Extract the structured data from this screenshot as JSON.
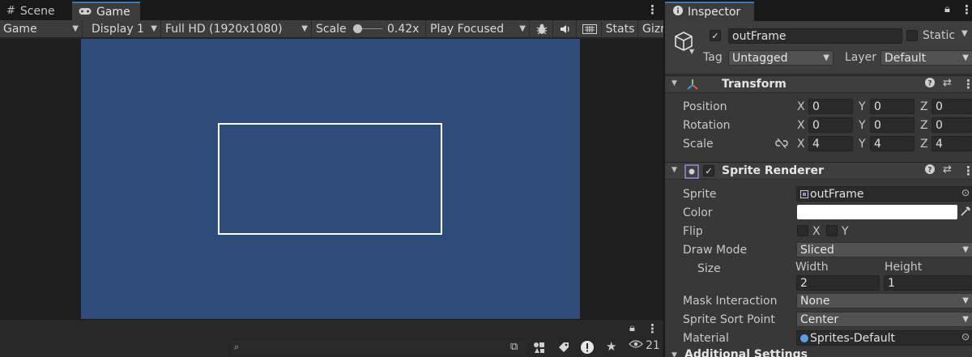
{
  "game_view": {
    "tabs": [
      {
        "label": "Scene",
        "icon": "hash-icon"
      },
      {
        "label": "Game",
        "icon": "gamepad-icon"
      }
    ],
    "toolbar": {
      "view_mode": "Game",
      "display": "Display 1",
      "resolution": "Full HD (1920x1080)",
      "scale_label": "Scale",
      "scale_value": "0.42x",
      "scale_fraction": 0.0,
      "play_mode": "Play Focused",
      "stats_label": "Stats",
      "gizmos_label": "Gizr"
    },
    "colors": {
      "canvas_bg": "#2e4b79",
      "frame_stroke": "#ffffff"
    }
  },
  "console": {
    "search_placeholder": "",
    "hidden_count": "21"
  },
  "inspector": {
    "tab_label": "Inspector",
    "object": {
      "active": true,
      "name": "outFrame",
      "static_label": "Static",
      "static_checked": false,
      "tag_label": "Tag",
      "tag_value": "Untagged",
      "layer_label": "Layer",
      "layer_value": "Default"
    },
    "transform": {
      "title": "Transform",
      "rows": [
        {
          "label": "Position",
          "x": "0",
          "y": "0",
          "z": "0"
        },
        {
          "label": "Rotation",
          "x": "0",
          "y": "0",
          "z": "0"
        },
        {
          "label": "Scale",
          "x": "4",
          "y": "4",
          "z": "4"
        }
      ],
      "axes": [
        "X",
        "Y",
        "Z"
      ]
    },
    "sprite_renderer": {
      "title": "Sprite Renderer",
      "enabled": true,
      "sprite_label": "Sprite",
      "sprite_value": "outFrame",
      "color_label": "Color",
      "color_value": "#ffffff",
      "flip_label": "Flip",
      "flip_x_label": "X",
      "flip_y_label": "Y",
      "draw_mode_label": "Draw Mode",
      "draw_mode_value": "Sliced",
      "size_label": "Size",
      "width_label": "Width",
      "height_label": "Height",
      "width_value": "2",
      "height_value": "1",
      "mask_label": "Mask Interaction",
      "mask_value": "None",
      "sort_point_label": "Sprite Sort Point",
      "sort_point_value": "Center",
      "material_label": "Material",
      "material_value": "Sprites-Default",
      "additional_label": "Additional Settings"
    }
  }
}
